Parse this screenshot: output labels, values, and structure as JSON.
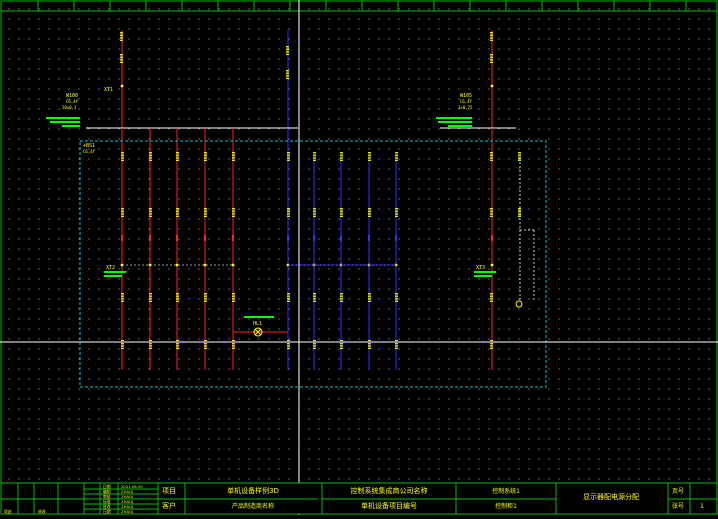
{
  "colors": {
    "background": "#000000",
    "frame": "#00c000",
    "grid_dot": "#6f6f6f",
    "power_wire": "#ff2020",
    "neutral_wire": "#3030ff",
    "text": "#ffff00",
    "device_text": "#00ff00",
    "box": "#00c8c8",
    "crosshair": "#ffffff",
    "busbar": "#ffffff",
    "dashline": "#c8c8c8"
  },
  "main_breakers": [
    {
      "tag": "W100",
      "spec1": "C6,4f",
      "spec2": "20x0,3"
    },
    {
      "tag": "W105",
      "spec1": "C6,4f",
      "spec2": "3x0,75"
    }
  ],
  "terminal_strips": [
    {
      "tag": "XT1"
    },
    {
      "tag": "XT2"
    },
    {
      "tag": "XT3"
    }
  ],
  "box": {
    "tag": "+BS1",
    "sub": "C6,4f"
  },
  "lamp": {
    "tag": "HL1"
  },
  "title_block": {
    "rev_rows": [
      {
        "a": "",
        "b": "",
        "c": "日期",
        "d": "2021.06.30"
      },
      {
        "a": "",
        "b": "",
        "c": "编制",
        "d": "ZHAOJ"
      },
      {
        "a": "",
        "b": "",
        "c": "审核",
        "d": "ZHAOJ"
      },
      {
        "a": "",
        "b": "",
        "c": "标准",
        "d": "ZHAOJ"
      },
      {
        "a": "",
        "b": "",
        "c": "修改",
        "d": "ZHAOJ"
      },
      {
        "a": "状态",
        "b": "修改",
        "c": "日期",
        "d": "ZHAOJ"
      }
    ],
    "project_label": "项目",
    "customer_label": "客户",
    "project_name": "单机设备样例3D",
    "customer_name": "产品制造商名称",
    "company_name": "控制系统集成商公司名称",
    "project_number": "单机设备项目编号",
    "system_name": "控制系统1",
    "cabinet_name": "控制柜1",
    "page_title": "显示器配电源分配",
    "page_label": "页号",
    "sheet_label": "张号",
    "page_value": "",
    "sheet_value": "1"
  }
}
